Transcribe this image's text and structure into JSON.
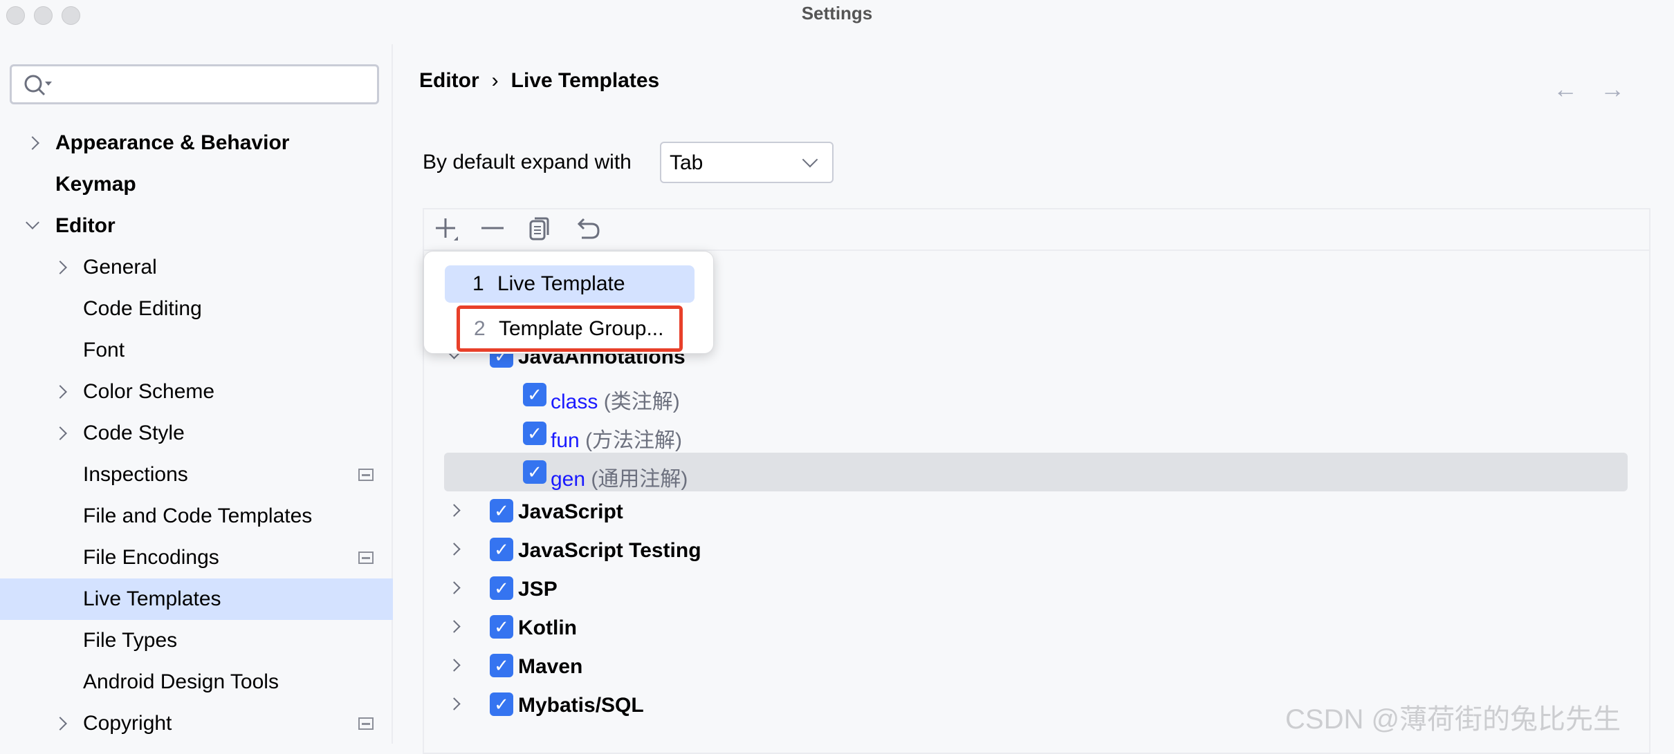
{
  "window": {
    "title": "Settings"
  },
  "sidebar": {
    "search": {
      "placeholder": "",
      "value": ""
    },
    "items": [
      {
        "label": "Appearance & Behavior",
        "level": 0,
        "bold": true,
        "chevron": "right"
      },
      {
        "label": "Keymap",
        "level": 0,
        "bold": true,
        "chevron": "none"
      },
      {
        "label": "Editor",
        "level": 0,
        "bold": true,
        "chevron": "down"
      },
      {
        "label": "General",
        "level": 1,
        "chevron": "right"
      },
      {
        "label": "Code Editing",
        "level": 1,
        "chevron": "none"
      },
      {
        "label": "Font",
        "level": 1,
        "chevron": "none"
      },
      {
        "label": "Color Scheme",
        "level": 1,
        "chevron": "right"
      },
      {
        "label": "Code Style",
        "level": 1,
        "chevron": "right"
      },
      {
        "label": "Inspections",
        "level": 1,
        "chevron": "none",
        "badge": true
      },
      {
        "label": "File and Code Templates",
        "level": 1,
        "chevron": "none"
      },
      {
        "label": "File Encodings",
        "level": 1,
        "chevron": "none",
        "badge": true
      },
      {
        "label": "Live Templates",
        "level": 1,
        "chevron": "none",
        "selected": true
      },
      {
        "label": "File Types",
        "level": 1,
        "chevron": "none"
      },
      {
        "label": "Android Design Tools",
        "level": 1,
        "chevron": "none"
      },
      {
        "label": "Copyright",
        "level": 1,
        "chevron": "right",
        "badge": true
      }
    ]
  },
  "header": {
    "breadcrumb": [
      "Editor",
      "Live Templates"
    ],
    "separator": "›"
  },
  "expand": {
    "label": "By default expand with",
    "value": "Tab"
  },
  "popup": {
    "items": [
      {
        "num": "1",
        "label": "Live Template"
      },
      {
        "num": "2",
        "label": "Template Group..."
      }
    ]
  },
  "tree": [
    {
      "label": "JavaAnnotations",
      "group": true,
      "expanded": true,
      "checked": true
    },
    {
      "label": "class",
      "desc": "(类注解)",
      "checked": true
    },
    {
      "label": "fun",
      "desc": "(方法注解)",
      "checked": true
    },
    {
      "label": "gen",
      "desc": "(通用注解)",
      "checked": true,
      "selected": true
    },
    {
      "label": "JavaScript",
      "group": true,
      "checked": true
    },
    {
      "label": "JavaScript Testing",
      "group": true,
      "checked": true
    },
    {
      "label": "JSP",
      "group": true,
      "checked": true
    },
    {
      "label": "Kotlin",
      "group": true,
      "checked": true
    },
    {
      "label": "Maven",
      "group": true,
      "checked": true
    },
    {
      "label": "Mybatis/SQL",
      "group": true,
      "checked": true
    }
  ],
  "watermark": "CSDN @薄荷街的兔比先生",
  "colors": {
    "accent": "#3574f0",
    "selection": "#d4e2ff",
    "highlight_box": "#e8402a",
    "link": "#1a1aff"
  }
}
